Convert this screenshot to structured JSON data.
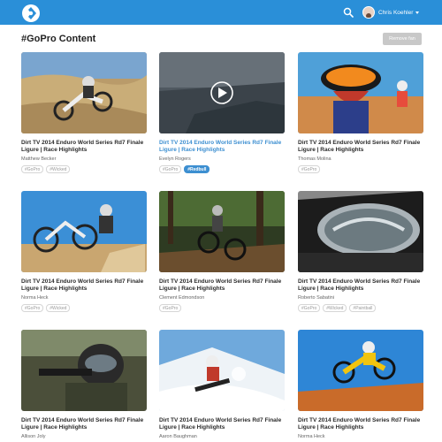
{
  "header": {
    "logo_icon": "gopro-logo-icon",
    "search_icon": "search-icon",
    "user_name": "Chris Koehler",
    "accent_color": "#2a8fd8"
  },
  "page": {
    "title": "#GoPro Content",
    "remove_label": "Remove fan"
  },
  "cards": [
    {
      "title": "Dirt TV 2014 Enduro World Series Rd7 Finale Ligure | Race Highlights",
      "author": "Matthew Becker",
      "tags": [
        "#GoPro",
        "#Wicked"
      ]
    },
    {
      "title": "Dirt TV 2014 Enduro World Series Rd7 Finale Ligure | Race Highlights",
      "author": "Evelyn Rogers",
      "tags": [
        "#GoPro",
        "#Redbull"
      ]
    },
    {
      "title": "Dirt TV 2014 Enduro World Series Rd7 Finale Ligure | Race Highlights",
      "author": "Thomas Molina",
      "tags": [
        "#GoPro"
      ]
    },
    {
      "title": "Dirt TV 2014 Enduro World Series Rd7 Finale Ligure | Race Highlights",
      "author": "Norma Heck",
      "tags": [
        "#GoPro",
        "#Wicked"
      ]
    },
    {
      "title": "Dirt TV 2014 Enduro World Series Rd7 Finale Ligure | Race Highlights",
      "author": "Clement Edmondson",
      "tags": [
        "#GoPro"
      ]
    },
    {
      "title": "Dirt TV 2014 Enduro World Series Rd7 Finale Ligure | Race Highlights",
      "author": "Roberto Sabatini",
      "tags": [
        "#GoPro",
        "#Wicked",
        "#Paintball"
      ]
    },
    {
      "title": "Dirt TV 2014 Enduro World Series Rd7 Finale Ligure | Race Highlights",
      "author": "Allison Joly",
      "tags": []
    },
    {
      "title": "Dirt TV 2014 Enduro World Series Rd7 Finale Ligure | Race Highlights",
      "author": "Aaron Baughman",
      "tags": []
    },
    {
      "title": "Dirt TV 2014 Enduro World Series Rd7 Finale Ligure | Race Highlights",
      "author": "Norma Heck",
      "tags": []
    }
  ],
  "active_card": 1,
  "active_tag": "#Redbull"
}
